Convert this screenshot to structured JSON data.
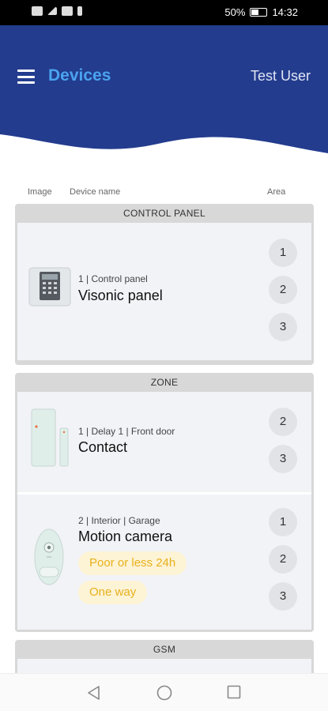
{
  "status_bar": {
    "battery": "50%",
    "time": "14:32"
  },
  "header": {
    "title": "Devices",
    "user": "Test User",
    "color": "#233c8e"
  },
  "columns": {
    "image": "Image",
    "device_name": "Device name",
    "area": "Area"
  },
  "groups": [
    {
      "title": "CONTROL PANEL",
      "devices": [
        {
          "meta": "1  |  Control panel",
          "name": "Visonic panel",
          "areas": [
            "1",
            "2",
            "3"
          ],
          "icon": "control-panel-icon"
        }
      ]
    },
    {
      "title": "ZONE",
      "devices": [
        {
          "meta": "1  |  Delay 1  |  Front door",
          "name": "Contact",
          "areas": [
            "2",
            "3"
          ],
          "icon": "door-contact-icon"
        },
        {
          "meta": "2  |  Interior  |  Garage",
          "name": "Motion camera",
          "areas": [
            "1",
            "2",
            "3"
          ],
          "chips": [
            "Poor or less 24h",
            "One way"
          ],
          "icon": "motion-camera-icon",
          "chip_color": "#e8b11d"
        }
      ]
    },
    {
      "title": "GSM"
    }
  ]
}
